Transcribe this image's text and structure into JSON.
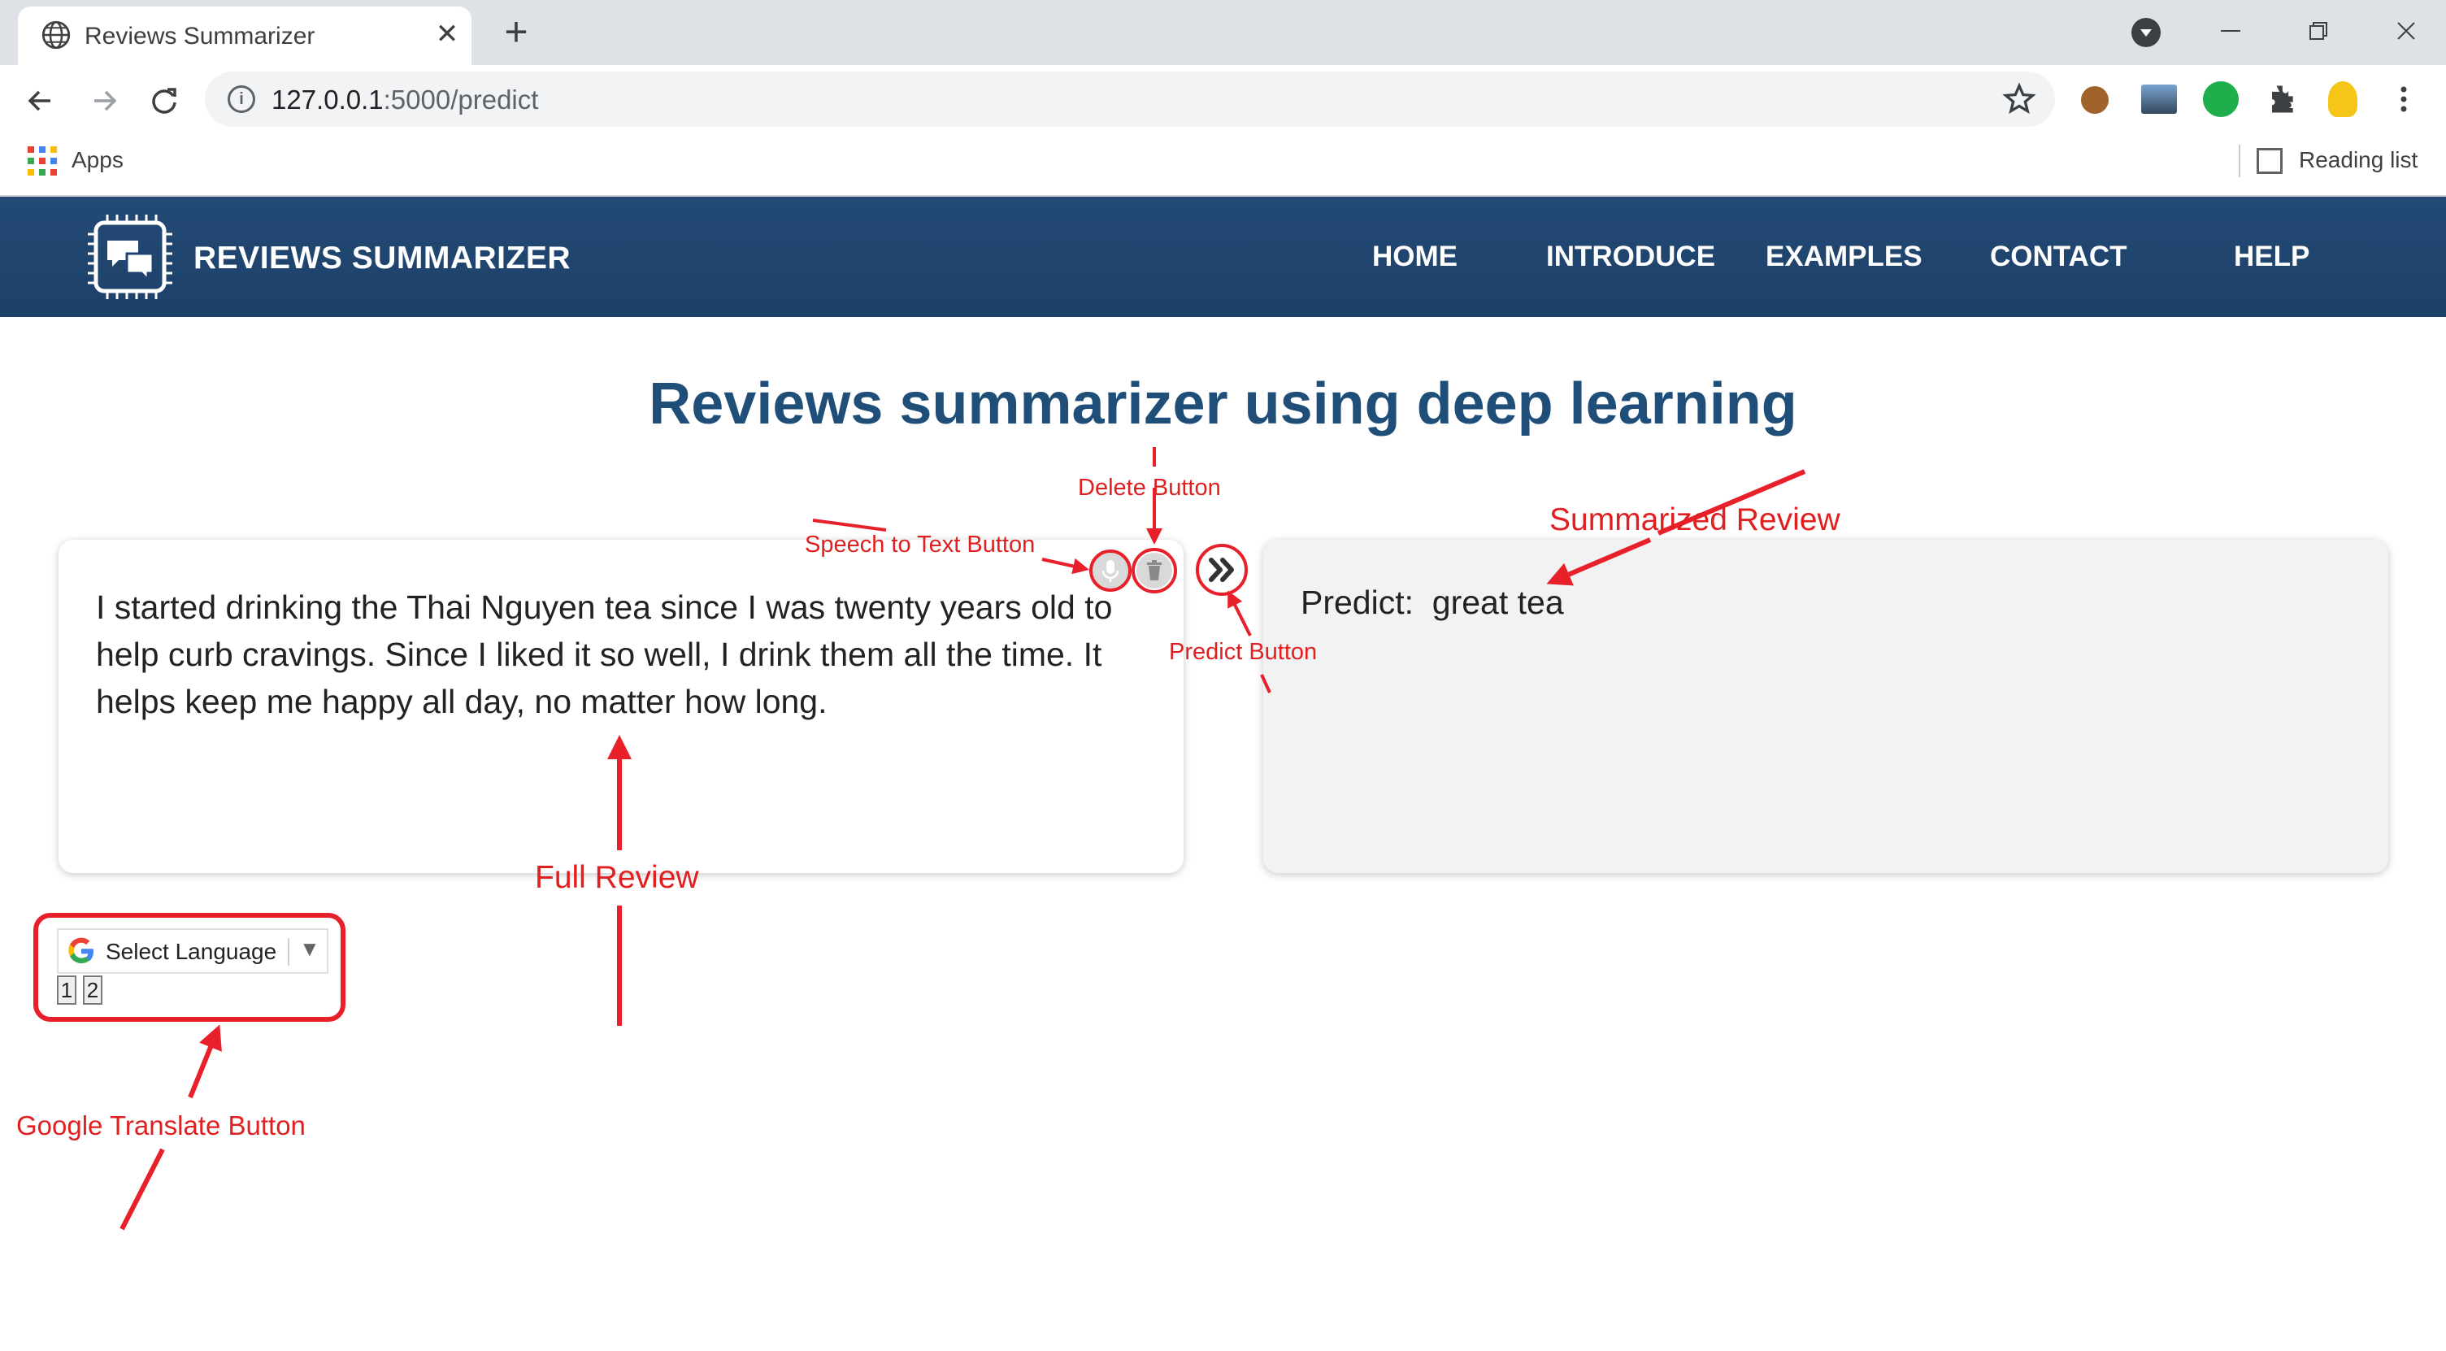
{
  "browser": {
    "tab_title": "Reviews Summarizer",
    "close_glyph": "✕",
    "new_tab_glyph": "+",
    "url_host": "127.0.0.1",
    "url_rest": ":5000/predict",
    "bookmarks_apps": "Apps",
    "reading_list": "Reading list",
    "icons": [
      "back-icon",
      "forward-icon",
      "reload-icon",
      "info-icon",
      "star-icon",
      "extensions-icon",
      "menu-icon"
    ]
  },
  "site": {
    "brand": "REVIEWS SUMMARIZER",
    "nav": [
      "HOME",
      "INTRODUCE",
      "EXAMPLES",
      "CONTACT",
      "HELP"
    ],
    "header_color": "#1f4472"
  },
  "main": {
    "title": "Reviews summarizer using deep learning",
    "review_text": "I started drinking the Thai Nguyen tea since I was twenty years old to help curb cravings. Since I liked it so well, I drink them all the time. It helps keep me happy all day, no matter how long.",
    "predict_label": "Predict:",
    "predict_value": "great tea"
  },
  "translate": {
    "label": "Select Language",
    "arrow": "▼",
    "chips": [
      "1",
      "2"
    ]
  },
  "annotations": {
    "delete": "Delete Button",
    "speech": "Speech to Text Button",
    "predict": "Predict Button",
    "summarized": "Summarized Review",
    "full": "Full Review",
    "google": "Google Translate Button",
    "color": "#e8202a"
  }
}
